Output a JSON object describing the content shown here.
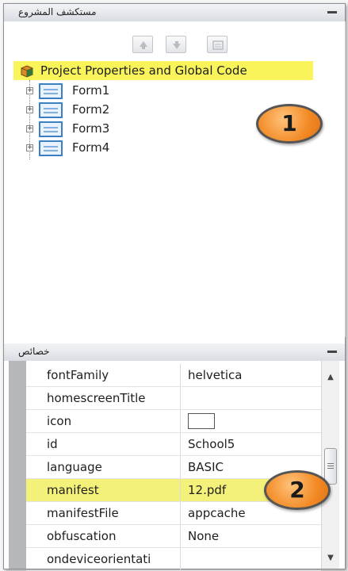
{
  "explorer": {
    "title": "مستكشف المشروع",
    "root": {
      "label": "Project Properties and Global Code"
    },
    "forms": [
      {
        "label": "Form1"
      },
      {
        "label": "Form2"
      },
      {
        "label": "Form3"
      },
      {
        "label": "Form4"
      }
    ],
    "badge": "1"
  },
  "properties": {
    "title": "خصائص",
    "rows": [
      {
        "name": "fontFamily",
        "value": "helvetica"
      },
      {
        "name": "homescreenTitle",
        "value": ""
      },
      {
        "name": "icon",
        "value": ""
      },
      {
        "name": "id",
        "value": "School5"
      },
      {
        "name": "language",
        "value": "BASIC"
      },
      {
        "name": "manifest",
        "value": "12.pdf"
      },
      {
        "name": "manifestFile",
        "value": "appcache"
      },
      {
        "name": "obfuscation",
        "value": "None"
      },
      {
        "name": "ondeviceorientati",
        "value": ""
      }
    ],
    "badge": "2"
  },
  "colors": {
    "highlight": "#f8f45a",
    "badge": "#f28a25",
    "form_icon": "#3d7fc4"
  }
}
